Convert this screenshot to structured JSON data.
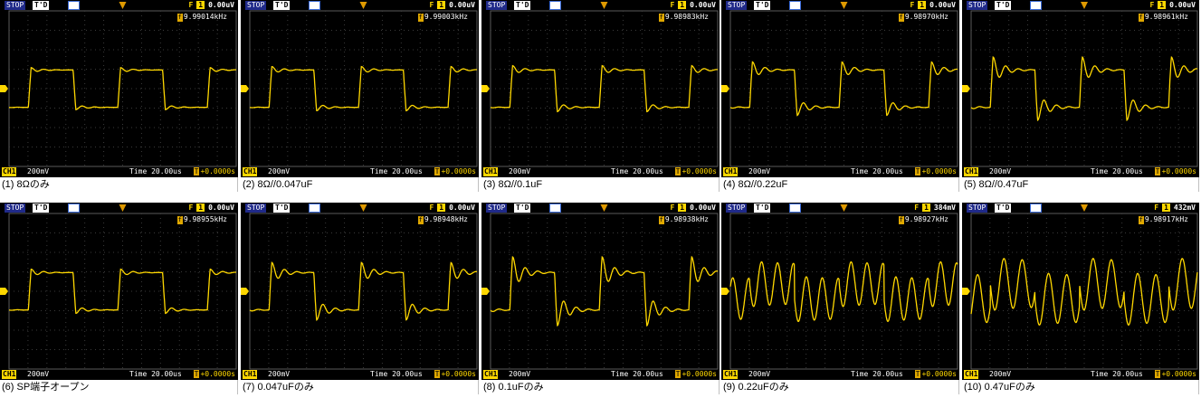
{
  "panels": [
    {
      "label": "(1) 8Ωのみ",
      "freq": "9.99014kHz",
      "trig": "0.00uV",
      "type": "sq",
      "ring": 0.08,
      "lvl": 1
    },
    {
      "label": "(2) 8Ω//0.047uF",
      "freq": "9.99003kHz",
      "trig": "0.00uV",
      "type": "sq",
      "ring": 0.12,
      "lvl": 1
    },
    {
      "label": "(3) 8Ω//0.1uF",
      "freq": "9.98983kHz",
      "trig": "0.00uV",
      "type": "sq",
      "ring": 0.15,
      "lvl": 1
    },
    {
      "label": "(4) 8Ω//0.22uF",
      "freq": "9.98970kHz",
      "trig": "0.00uV",
      "type": "sq",
      "ring": 0.28,
      "lvl": 1
    },
    {
      "label": "(5) 8Ω//0.47uF",
      "freq": "9.98961kHz",
      "trig": "0.00uV",
      "type": "sq",
      "ring": 0.45,
      "lvl": 1
    },
    {
      "label": "(6) SP端子オープン",
      "freq": "9.98955kHz",
      "trig": "0.00uV",
      "type": "sq",
      "ring": 0.12,
      "lvl": 2
    },
    {
      "label": "(7) 0.047uFのみ",
      "freq": "9.98948kHz",
      "trig": "0.00uV",
      "type": "sq",
      "ring": 0.35,
      "lvl": 2
    },
    {
      "label": "(8) 0.1uFのみ",
      "freq": "9.98938kHz",
      "trig": "0.00uV",
      "type": "sq",
      "ring": 0.55,
      "lvl": 2
    },
    {
      "label": "(9) 0.22uFのみ",
      "freq": "9.98927kHz",
      "trig": "384mV",
      "type": "osc",
      "ring": 0,
      "lvl": 2
    },
    {
      "label": "(10) 0.47uFのみ",
      "freq": "9.98917kHz",
      "trig": "432mV",
      "type": "osc2",
      "ring": 0,
      "lvl": 2
    }
  ],
  "scope": {
    "status_badge": "STOP",
    "trig_mode": "T'D",
    "trig_icon": "F",
    "ch_indicator": "1",
    "channel": "CH1",
    "volts_div": "200mV",
    "time_div": "Time 20.00us",
    "time_offset": "+0.0000s",
    "trace_color": "#ffd800"
  }
}
